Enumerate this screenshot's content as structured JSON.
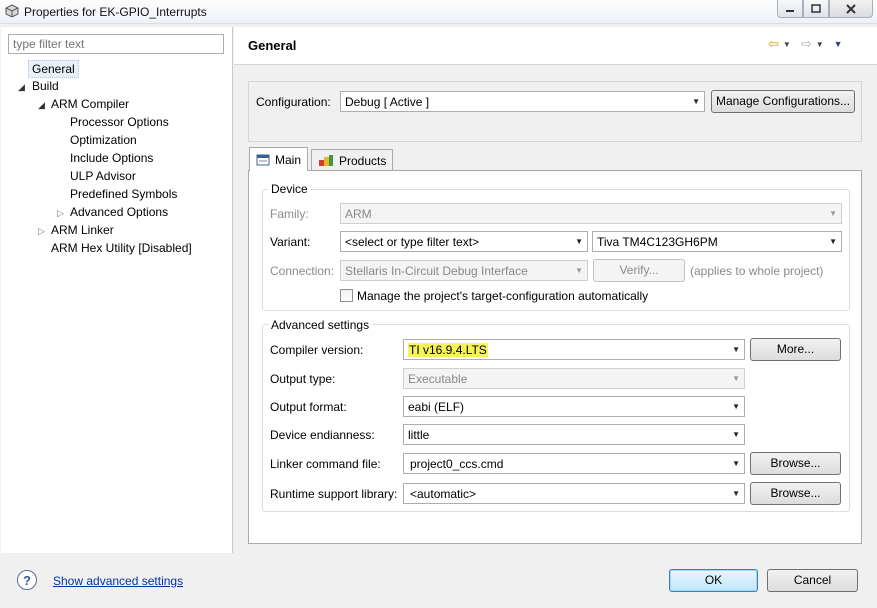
{
  "window": {
    "title": "Properties for EK-GPIO_Interrupts"
  },
  "filter": {
    "placeholder": "type filter text"
  },
  "tree": {
    "general": "General",
    "build": "Build",
    "arm_compiler": "ARM Compiler",
    "processor_options": "Processor Options",
    "optimization": "Optimization",
    "include_options": "Include Options",
    "ulp_advisor": "ULP Advisor",
    "predefined_symbols": "Predefined Symbols",
    "advanced_options": "Advanced Options",
    "arm_linker": "ARM Linker",
    "arm_hex_utility": "ARM Hex Utility  [Disabled]"
  },
  "header": {
    "title": "General"
  },
  "config": {
    "label": "Configuration:",
    "value": "Debug  [ Active ]",
    "manage_button": "Manage Configurations..."
  },
  "tabs": {
    "main": "Main",
    "products": "Products"
  },
  "device": {
    "group_title": "Device",
    "family_label": "Family:",
    "family_value": "ARM",
    "variant_label": "Variant:",
    "variant_filter": "<select or type filter text>",
    "variant_value": "Tiva TM4C123GH6PM",
    "connection_label": "Connection:",
    "connection_value": "Stellaris In-Circuit Debug Interface",
    "verify_button": "Verify...",
    "applies_note": "(applies to whole project)",
    "manage_checkbox_label": "Manage the project's target-configuration automatically",
    "manage_checked": false
  },
  "advanced": {
    "group_title": "Advanced settings",
    "compiler_label": "Compiler version:",
    "compiler_value": "TI v16.9.4.LTS",
    "more_button": "More...",
    "output_type_label": "Output type:",
    "output_type_value": "Executable",
    "output_format_label": "Output format:",
    "output_format_value": "eabi (ELF)",
    "endianness_label": "Device endianness:",
    "endianness_value": "little",
    "linker_label": "Linker command file:",
    "linker_value": "project0_ccs.cmd",
    "browse_button_1": "Browse...",
    "runtime_label": "Runtime support library:",
    "runtime_value": "<automatic>",
    "browse_button_2": "Browse..."
  },
  "footer": {
    "advanced_link": "Show advanced settings",
    "ok_button": "OK",
    "cancel_button": "Cancel"
  },
  "colors": {
    "highlight": "#f6f25a",
    "link": "#0033aa"
  }
}
